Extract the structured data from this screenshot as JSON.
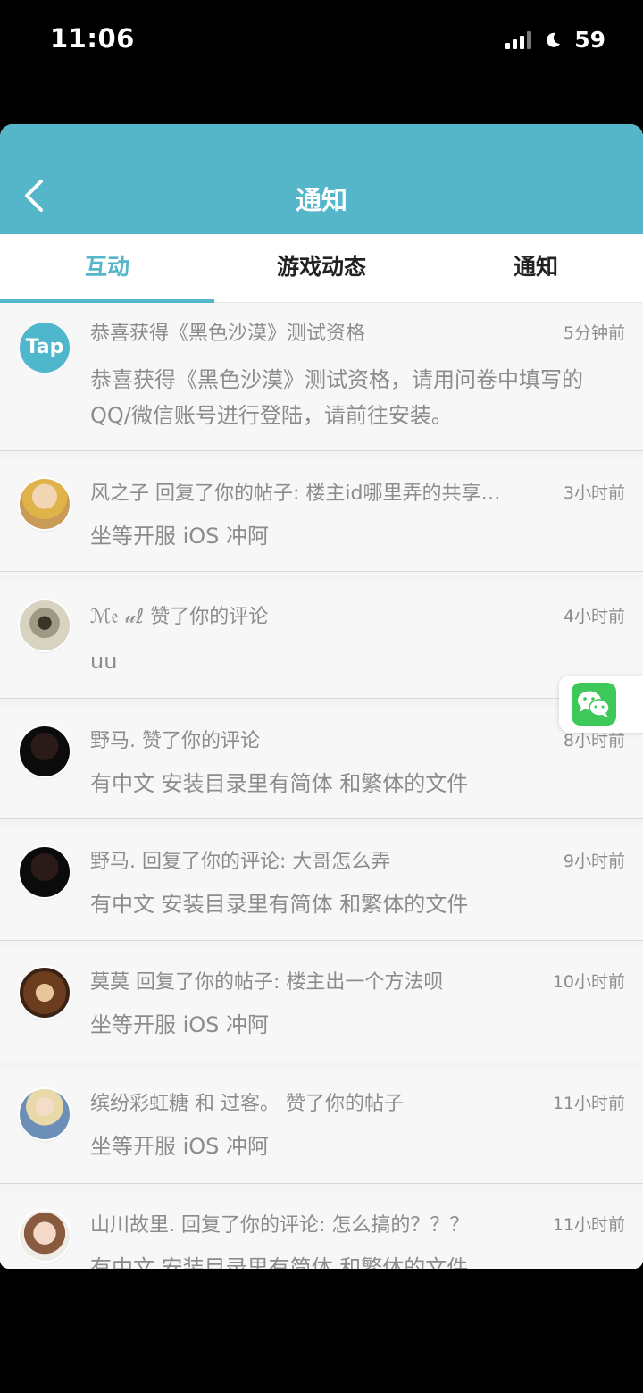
{
  "status": {
    "time": "11:06",
    "battery": "59"
  },
  "nav": {
    "title": "通知"
  },
  "tabs": [
    {
      "label": "互动",
      "active": true
    },
    {
      "label": "游戏动态",
      "active": false
    },
    {
      "label": "通知",
      "active": false
    }
  ],
  "items": [
    {
      "avatar": "tap-logo",
      "avatar_text": "Tap",
      "head": "恭喜获得《黑色沙漠》测试资格",
      "time": "5分钟前",
      "body": "恭喜获得《黑色沙漠》测试资格，请用问卷中填写的QQ/微信账号进行登陆，请前往安装。"
    },
    {
      "avatar": "anime-girl-blonde",
      "head": "风之子 回复了你的帖子: 楼主id哪里弄的共享…",
      "time": "3小时前",
      "body": "坐等开服 iOS 冲阿"
    },
    {
      "avatar": "sketch-figure",
      "head": "ℳ𝔢 𝓊ℓ 赞了你的评论",
      "time": "4小时前",
      "body": "uu"
    },
    {
      "avatar": "dark-hood",
      "head": "野马. 赞了你的评论",
      "time": "8小时前",
      "body": "有中文 安装目录里有简体 和繁体的文件"
    },
    {
      "avatar": "dark-hood",
      "head": "野马. 回复了你的评论: 大哥怎么弄",
      "time": "9小时前",
      "body": "有中文 安装目录里有简体 和繁体的文件"
    },
    {
      "avatar": "doll-face",
      "head": "莫莫 回复了你的帖子: 楼主出一个方法呗",
      "time": "10小时前",
      "body": "坐等开服 iOS 冲阿"
    },
    {
      "avatar": "anime-girl-blue",
      "head": "缤纷彩虹糖 和 过客。 赞了你的帖子",
      "time": "11小时前",
      "body": "坐等开服 iOS 冲阿"
    },
    {
      "avatar": "anime-boy",
      "head": "山川故里. 回复了你的评论: 怎么搞的？？？",
      "time": "11小时前",
      "body": "有中文 安装目录里有简体 和繁体的文件"
    }
  ],
  "colors": {
    "accent": "#55b6c9",
    "text_gray": "#8c8c8c",
    "wechat": "#3fc85a"
  },
  "float_button": {
    "icon": "wechat-icon"
  }
}
